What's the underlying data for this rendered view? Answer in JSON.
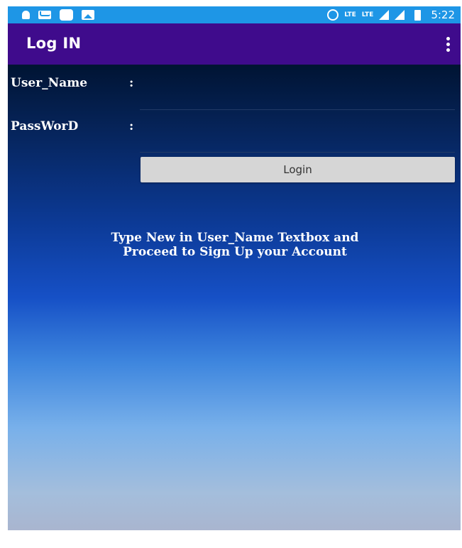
{
  "status_bar": {
    "time": "5:22",
    "lte1": "LTE",
    "lte2": "LTE",
    "left_icons": [
      "bell-icon",
      "mail-icon",
      "chat-icon",
      "image-icon"
    ],
    "right_icons": [
      "alarm-icon",
      "lte-call-icon",
      "signal-icon",
      "signal-icon",
      "battery-icon"
    ]
  },
  "app_bar": {
    "title": "Log IN",
    "menu_icon": "overflow-menu-icon",
    "color": "#3f0b8c"
  },
  "form": {
    "username_label": "User_Name",
    "password_label": "PassWorD",
    "colon": ":",
    "username_value": "",
    "password_value": "",
    "login_label": "Login"
  },
  "hint": {
    "line1": "Type New in User_Name Textbox and",
    "line2": "Proceed to Sign Up your Account"
  },
  "colors": {
    "status_bar": "#1e96e6",
    "button": "#d6d6d6"
  }
}
